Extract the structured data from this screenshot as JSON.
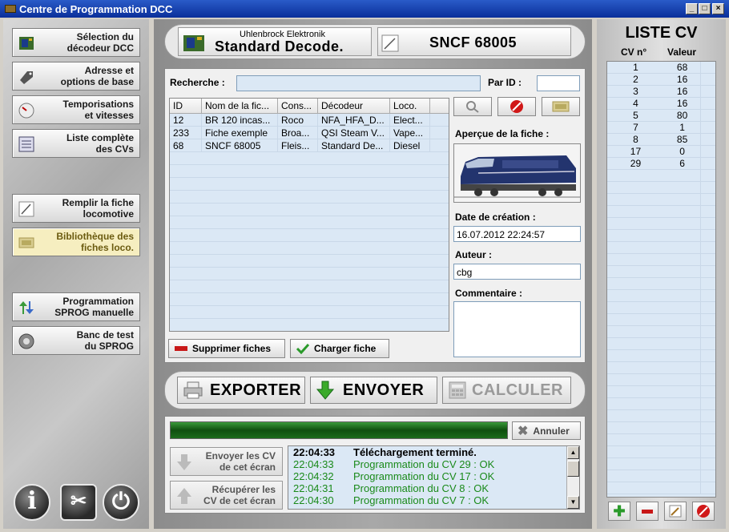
{
  "window": {
    "title": "Centre de Programmation DCC"
  },
  "sidebar": {
    "items": [
      {
        "label1": "Sélection du",
        "label2": "décodeur DCC",
        "icon": "decoder-chip-icon"
      },
      {
        "label1": "Adresse et",
        "label2": "options de base",
        "icon": "tag-icon"
      },
      {
        "label1": "Temporisations",
        "label2": "et vitesses",
        "icon": "gauge-icon"
      },
      {
        "label1": "Liste complète",
        "label2": "des CVs",
        "icon": "list-icon"
      },
      {
        "label1": "Remplir la fiche",
        "label2": "locomotive",
        "icon": "pencil-icon"
      },
      {
        "label1": "Bibliothèque des",
        "label2": "fiches loco.",
        "icon": "library-icon"
      },
      {
        "label1": "Programmation",
        "label2": "SPROG manuelle",
        "icon": "arrows-icon"
      },
      {
        "label1": "Banc de test",
        "label2": "du SPROG",
        "icon": "test-bench-icon"
      }
    ],
    "bottom": {
      "info": "i",
      "tools": "tools-icon",
      "power": "power-icon"
    }
  },
  "header": {
    "maker": "Uhlenbrock Elektronik",
    "decoder": "Standard Decode.",
    "loco": "SNCF 68005"
  },
  "search": {
    "label": "Recherche :",
    "value": "",
    "id_label": "Par ID :",
    "id_value": ""
  },
  "filelist": {
    "columns": [
      "ID",
      "Nom de la fic...",
      "Cons...",
      "Décodeur",
      "Loco."
    ],
    "rows": [
      [
        "12",
        "BR 120 incas...",
        "Roco",
        "NFA_HFA_D...",
        "Elect..."
      ],
      [
        "233",
        "Fiche exemple",
        "Broa...",
        "QSI Steam V...",
        "Vape..."
      ],
      [
        "68",
        "SNCF 68005",
        "Fleis...",
        "Standard De...",
        "Diesel"
      ]
    ]
  },
  "preview": {
    "label": "Aperçue de la fiche :",
    "date_label": "Date de création :",
    "date_value": "16.07.2012 22:24:57",
    "author_label": "Auteur :",
    "author_value": "cbg",
    "comment_label": "Commentaire :",
    "comment_value": ""
  },
  "actions": {
    "delete": "Supprimer fiches",
    "load": "Charger fiche",
    "export": "EXPORTER",
    "send": "ENVOYER",
    "calc": "CALCULER",
    "cancel": "Annuler",
    "send_cv1": "Envoyer les CV",
    "send_cv2": "de cet écran",
    "get_cv1": "Récupérer les",
    "get_cv2": "CV de cet écran"
  },
  "progress": {
    "value": 1.0,
    "color": "#1b6b1b"
  },
  "log": [
    {
      "time": "22:04:33",
      "msg": "Téléchargement terminé.",
      "bold": true
    },
    {
      "time": "22:04:33",
      "msg": "Programmation du CV 29 : OK"
    },
    {
      "time": "22:04:32",
      "msg": "Programmation du CV 17 : OK"
    },
    {
      "time": "22:04:31",
      "msg": "Programmation du CV 8 : OK"
    },
    {
      "time": "22:04:30",
      "msg": "Programmation du CV 7 : OK"
    }
  ],
  "cv": {
    "title": "LISTE CV",
    "col1": "CV n°",
    "col2": "Valeur",
    "rows": [
      [
        "1",
        "68"
      ],
      [
        "2",
        "16"
      ],
      [
        "3",
        "16"
      ],
      [
        "4",
        "16"
      ],
      [
        "5",
        "80"
      ],
      [
        "7",
        "1"
      ],
      [
        "8",
        "85"
      ],
      [
        "17",
        "0"
      ],
      [
        "29",
        "6"
      ]
    ]
  }
}
